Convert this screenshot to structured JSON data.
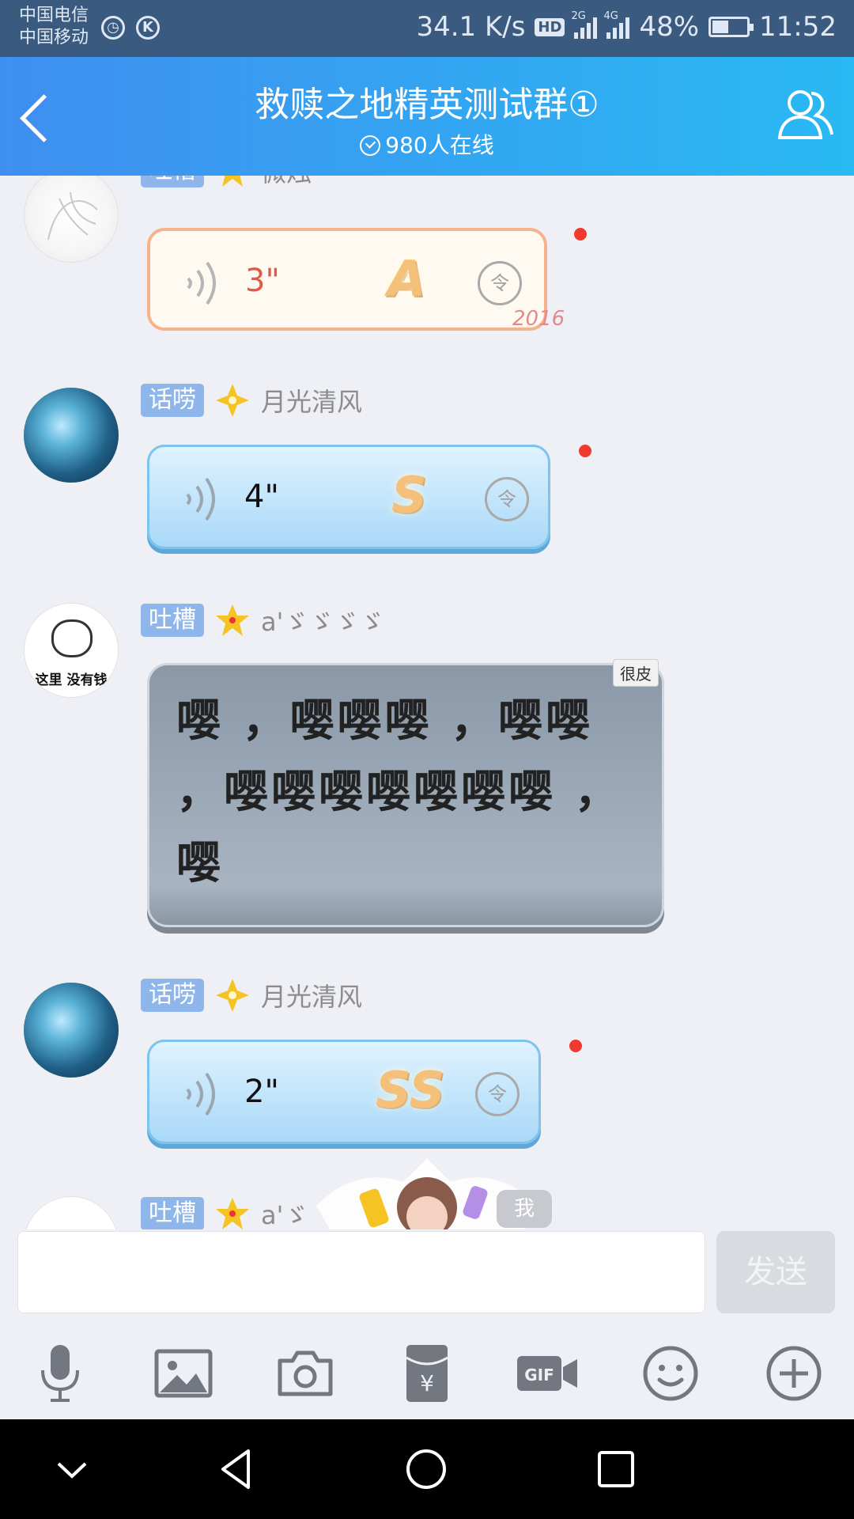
{
  "status_bar": {
    "carrier_1": "中国电信",
    "carrier_2": "中国移动",
    "k_icon": "K",
    "speed": "34.1 K/s",
    "hd": "HD",
    "net_1": "2G",
    "net_2": "4G",
    "battery": "48%",
    "time": "11:52"
  },
  "header": {
    "title": "救赎之地精英测试群①",
    "online": "980人在线"
  },
  "messages": [
    {
      "tag": "吐槽",
      "name": "微烛",
      "duration": "3\"",
      "letter": "A",
      "cmd": "令",
      "decor": "2016"
    },
    {
      "tag": "话唠",
      "name": "月光清风",
      "duration": "4\"",
      "letter": "S",
      "cmd": "令"
    },
    {
      "tag": "吐槽",
      "name": "a'ゞゞゞゞ",
      "avatar_text": "这里 没有钱",
      "corner": "很皮",
      "text": "嘤 ，嘤嘤嘤 ，嘤嘤 ，嘤嘤嘤嘤嘤嘤嘤 ，嘤"
    },
    {
      "tag": "话唠",
      "name": "月光清风",
      "duration": "2\"",
      "letter": "SS",
      "cmd": "令"
    },
    {
      "tag": "吐槽",
      "name": "a'ゞ",
      "me_tag": "我"
    }
  ],
  "input": {
    "send_label": "发送",
    "value": ""
  },
  "colors": {
    "title_gradient_start": "#3f8ff0",
    "title_gradient_end": "#29b9f3",
    "tag_bg": "#8fb6ea",
    "unread_dot": "#f03a2e",
    "status_bar": "#3a5a80"
  },
  "icons": {
    "toolbar": [
      "microphone-icon",
      "image-icon",
      "camera-icon",
      "red-packet-icon",
      "gif-icon",
      "emoji-icon",
      "plus-icon"
    ],
    "navbar": [
      "chevron-down-icon",
      "back-triangle-icon",
      "home-circle-icon",
      "recents-square-icon"
    ]
  }
}
